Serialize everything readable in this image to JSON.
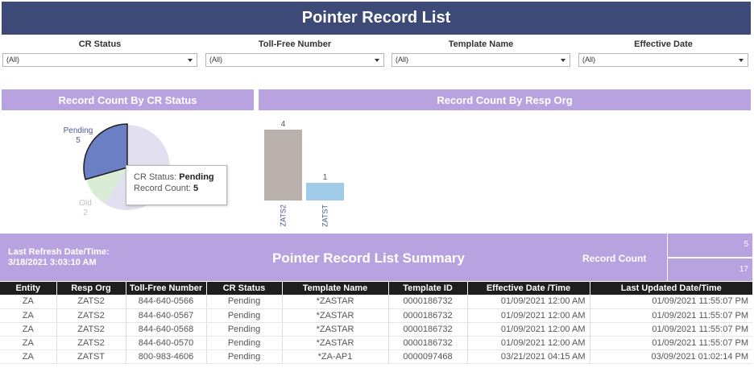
{
  "header": {
    "title": "Pointer Record List"
  },
  "filters": [
    {
      "label": "CR Status",
      "value": "(All)"
    },
    {
      "label": "Toll-Free Number",
      "value": "(All)"
    },
    {
      "label": "Template Name",
      "value": "(All)"
    },
    {
      "label": "Effective Date",
      "value": "(All)"
    }
  ],
  "sections": {
    "cr_status": "Record Count By CR Status",
    "resp_org": "Record Count By Resp Org"
  },
  "tooltip": {
    "key1": "CR Status:",
    "val1": "Pending",
    "key2": "Record Count:",
    "val2": "5"
  },
  "chart_data": [
    {
      "type": "pie",
      "title": "Record Count By CR Status",
      "slices": [
        {
          "label": "Pending",
          "value": 5,
          "color": "#6b7fc4"
        },
        {
          "label": "Old",
          "value": 2,
          "color": "#d9ecd6"
        },
        {
          "label": "",
          "value": 10,
          "color": "#e2dff0"
        }
      ]
    },
    {
      "type": "bar",
      "title": "Record Count By Resp Org",
      "categories": [
        "ZATS2",
        "ZATST"
      ],
      "values": [
        4,
        1
      ],
      "colors": [
        "#bab0ab",
        "#a0cbe8"
      ]
    }
  ],
  "summary": {
    "refresh_label": "Last Refresh Date/Time:",
    "refresh_value": "3/18/2021 3:03:10 AM",
    "title": "Pointer Record List Summary",
    "record_count_label": "Record Count",
    "counts": [
      "5",
      "17"
    ]
  },
  "table": {
    "columns": [
      "Entity",
      "Resp Org",
      "Toll-Free Number",
      "CR Status",
      "Template Name",
      "Template ID",
      "Effective Date /Time",
      "Last Updated Date/Time"
    ],
    "rows": [
      [
        "ZA",
        "ZATS2",
        "844-640-0566",
        "Pending",
        "*ZASTAR",
        "0000186732",
        "01/09/2021 12:00 AM",
        "01/09/2021 11:55:07 PM"
      ],
      [
        "ZA",
        "ZATS2",
        "844-640-0567",
        "Pending",
        "*ZASTAR",
        "0000186732",
        "01/09/2021 12:00 AM",
        "01/09/2021 11:55:07 PM"
      ],
      [
        "ZA",
        "ZATS2",
        "844-640-0568",
        "Pending",
        "*ZASTAR",
        "0000186732",
        "01/09/2021 12:00 AM",
        "01/09/2021 11:55:07 PM"
      ],
      [
        "ZA",
        "ZATS2",
        "844-640-0570",
        "Pending",
        "*ZASTAR",
        "0000186732",
        "01/09/2021 12:00 AM",
        "01/09/2021 11:55:07 PM"
      ],
      [
        "ZA",
        "ZATST",
        "800-983-4606",
        "Pending",
        "*ZA-AP1",
        "0000097468",
        "03/21/2021 04:15 AM",
        "03/09/2021 01:02:14 PM"
      ]
    ]
  }
}
